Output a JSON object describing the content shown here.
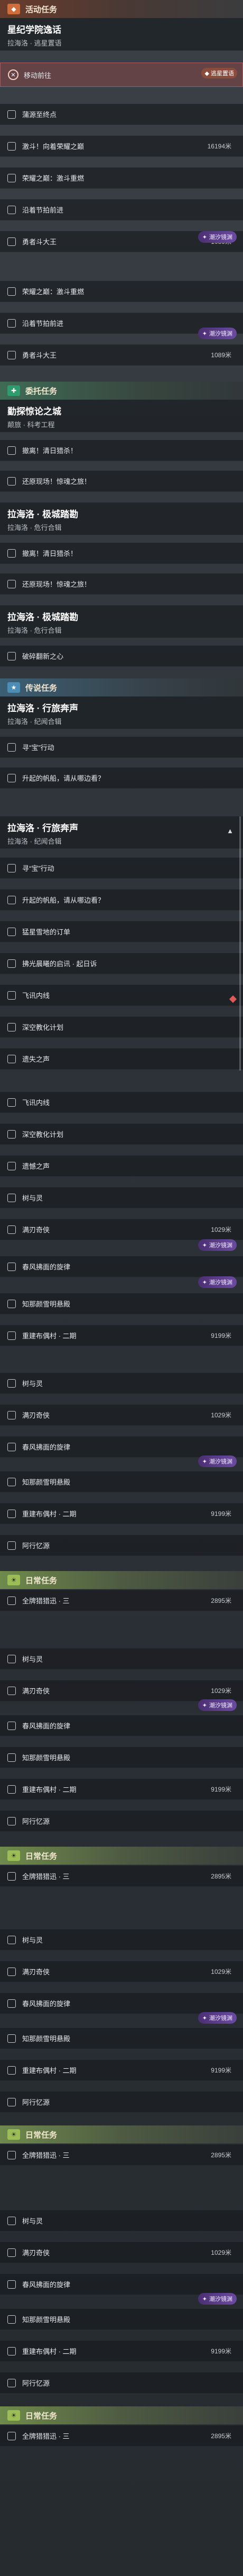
{
  "sections": {
    "event": {
      "label": "活动任务"
    },
    "commission": {
      "label": "委托任务"
    },
    "legend": {
      "label": "传说任务"
    },
    "daily": {
      "label": "日常任务"
    }
  },
  "quest1": {
    "title": "星纪学院逸话",
    "subtitle": "拉海洛 · 逃星置语",
    "ongoing_label": "移动前往",
    "track_label": "◆ 逃星置语"
  },
  "quest1_items": [
    {
      "label": "蒲源至终点",
      "value": ""
    },
    {
      "label": "激斗！向着荣耀之巅",
      "value": "16194米"
    },
    {
      "label": "荣耀之巅：激斗重燃",
      "value": ""
    },
    {
      "label": "沿着节拍前进",
      "value": ""
    },
    {
      "label": "勇者斗大王",
      "value": "1089米"
    }
  ],
  "quest2_items": [
    {
      "label": "荣耀之巅：激斗重燃",
      "value": ""
    },
    {
      "label": "沿着节拍前进",
      "value": ""
    },
    {
      "label": "勇者斗大王",
      "value": "1089米"
    }
  ],
  "tags": {
    "event": "潮汐镜渊"
  },
  "quest3": {
    "title": "勤探惊论之城",
    "subtitle": "颠旅 · 科考工程"
  },
  "quest3_items": [
    {
      "label": "撤离！清日猎杀！"
    },
    {
      "label": "还原现场！惊魂之旅！"
    }
  ],
  "quest4": {
    "title": "拉海洛 · 极城踏勘",
    "subtitle": "拉海洛 · 危行合辑"
  },
  "quest4_items": [
    {
      "label": "撤离！清日猎杀！"
    },
    {
      "label": "还原现场！惊魂之旅！"
    }
  ],
  "quest5": {
    "title": "拉海洛 · 极城踏勘",
    "subtitle": "拉海洛 · 危行合辑"
  },
  "quest5_items": [
    {
      "label": "破碎翻新之心"
    }
  ],
  "quest6": {
    "title": "拉海洛 · 行旅奔声",
    "subtitle": "拉海洛 · 纪闻合辑"
  },
  "quest6_items": [
    {
      "label": "寻“宝”行动"
    },
    {
      "label": "升起的帆船，请从哪边看？"
    }
  ],
  "quest7": {
    "title": "拉海洛 · 行旅奔声",
    "subtitle": "拉海洛 · 纪闻合辑"
  },
  "quest7_items": [
    {
      "label": "寻“宝”行动"
    },
    {
      "label": "升起的帆船，请从哪边看？"
    },
    {
      "label": "猛星雪地的订单"
    },
    {
      "label": "拂光晨曦的启讯 · 起日诉"
    },
    {
      "label": "飞讯内线"
    },
    {
      "label": "深空教化计划"
    },
    {
      "label": "遗失之声"
    }
  ],
  "list_a": [
    {
      "label": "飞讯内线",
      "value": ""
    },
    {
      "label": "深空教化计划",
      "value": ""
    },
    {
      "label": "遗憾之声",
      "value": ""
    },
    {
      "label": "树与灵",
      "value": ""
    },
    {
      "label": "满刃奇侠",
      "value": "1029米"
    },
    {
      "label": "春风拂面的旋律",
      "value": ""
    },
    {
      "label": "知那颜雪明悬殿",
      "value": ""
    },
    {
      "label": "重建布偶村 · 二期",
      "value": "9199米"
    }
  ],
  "list_b": [
    {
      "label": "树与灵",
      "value": ""
    },
    {
      "label": "满刃奇侠",
      "value": "1029米"
    },
    {
      "label": "春风拂面的旋律",
      "value": ""
    },
    {
      "label": "知那颜雪明悬殿",
      "value": ""
    },
    {
      "label": "重建布偶村 · 二期",
      "value": "9199米"
    },
    {
      "label": "阿行忆源",
      "value": ""
    }
  ],
  "daily_item": {
    "label": "全牌猎猎迅 · 三",
    "value": "2895米"
  }
}
